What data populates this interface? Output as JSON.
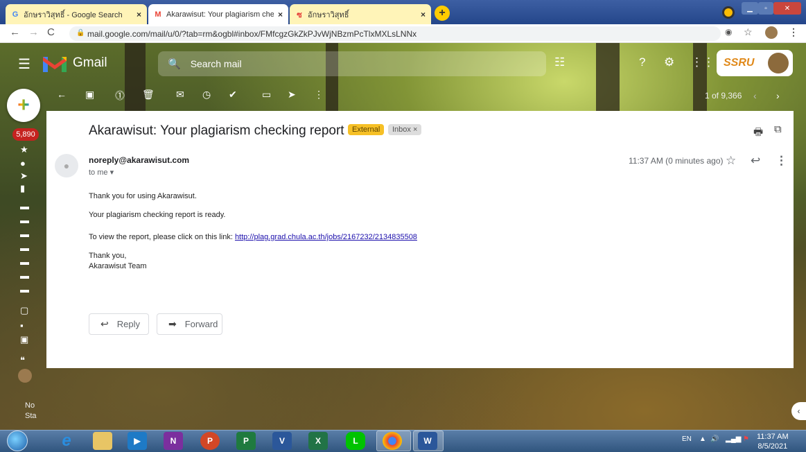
{
  "browser": {
    "tabs": [
      {
        "title": "อักษราวิสุทธิ์ - Google Search",
        "icon": "google-icon",
        "active": false
      },
      {
        "title": "Akarawisut: Your plagiarism chec",
        "icon": "gmail-icon",
        "active": true
      },
      {
        "title": "อักษราวิสุทธิ์",
        "icon": "akarawisut-icon",
        "active": false
      }
    ],
    "new_tab_label": "+",
    "url": "mail.google.com/mail/u/0/?tab=rm&ogbl#inbox/FMfcgzGkZkPJvWjNBzmPcTlxMXLsLNNx"
  },
  "gmail": {
    "brand": "Gmail",
    "search_placeholder": "Search mail",
    "pager": "1 of 9,366",
    "profile_logo_text": "SSRU",
    "unread_count": "5,890",
    "rail_bottom_text_1": "No",
    "rail_bottom_text_2": "Sta"
  },
  "email": {
    "subject": "Akarawisut: Your plagiarism checking report",
    "label_external": "External",
    "label_inbox": "Inbox ×",
    "sender": "noreply@akarawisut.com",
    "to": "to me ▾",
    "time": "11:37 AM (0 minutes ago)",
    "body": {
      "line1": "Thank you for using Akarawisut.",
      "line2": "Your plagiarism checking report is ready.",
      "line3_prefix": "To view the report, please click on this link: ",
      "link": "http://plag.grad.chula.ac.th/jobs/2167232/2134835508",
      "sign1": "Thank you,",
      "sign2": "Akarawisut Team"
    },
    "reply_label": "Reply",
    "forward_label": "Forward"
  },
  "taskbar": {
    "lang": "EN",
    "time": "11:37 AM",
    "date": "8/5/2021"
  },
  "colors": {
    "external_label": "#f6c026",
    "unread_badge": "#c5221f",
    "link": "#1a0dab"
  }
}
